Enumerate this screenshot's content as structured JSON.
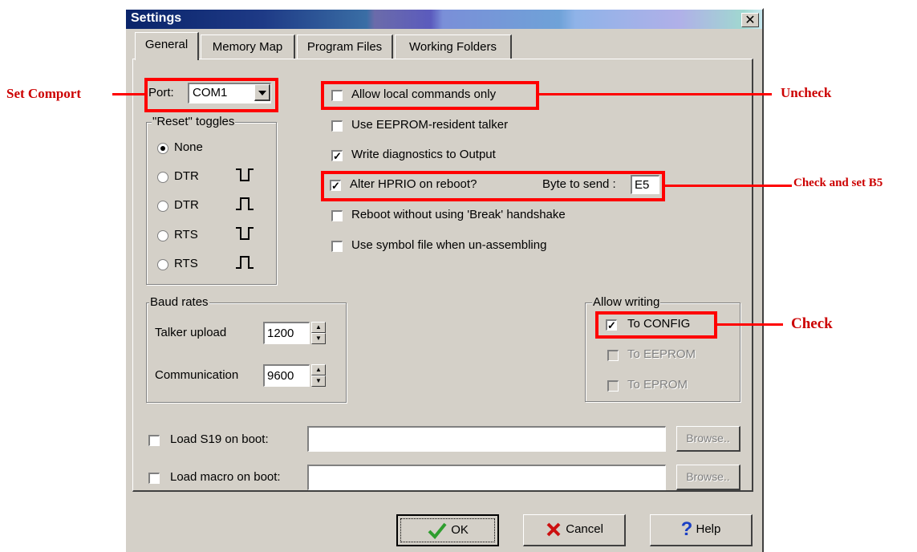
{
  "dialog": {
    "title": "Settings",
    "close_glyph": "✕",
    "tabs": [
      "General",
      "Memory Map",
      "Program Files",
      "Working Folders"
    ],
    "active_tab": "General"
  },
  "port": {
    "label": "Port:",
    "value": "COM1"
  },
  "reset_toggles": {
    "label": "\"Reset\" toggles",
    "options": [
      {
        "label": "None",
        "selected": true,
        "icon": "none"
      },
      {
        "label": "DTR",
        "selected": false,
        "icon": "pulse-low-icon"
      },
      {
        "label": "DTR",
        "selected": false,
        "icon": "pulse-high-icon"
      },
      {
        "label": "RTS",
        "selected": false,
        "icon": "pulse-low-icon"
      },
      {
        "label": "RTS",
        "selected": false,
        "icon": "pulse-high-icon"
      }
    ]
  },
  "options": [
    {
      "label": "Allow local commands only",
      "checked": false
    },
    {
      "label": "Use EEPROM-resident talker",
      "checked": false
    },
    {
      "label": "Write diagnostics to Output",
      "checked": true
    },
    {
      "label": "Alter HPRIO on reboot?",
      "checked": true
    },
    {
      "label": "Reboot without using 'Break' handshake",
      "checked": false
    },
    {
      "label": "Use symbol file when un-assembling",
      "checked": false
    }
  ],
  "byte_to_send": {
    "label": "Byte to send :",
    "value": "E5"
  },
  "baud_rates": {
    "label": "Baud rates",
    "talker_upload": {
      "label": "Talker upload",
      "value": "1200"
    },
    "communication": {
      "label": "Communication",
      "value": "9600"
    }
  },
  "allow_writing": {
    "label": "Allow writing",
    "items": [
      {
        "label": "To CONFIG",
        "checked": true,
        "enabled": true
      },
      {
        "label": "To EEPROM",
        "checked": false,
        "enabled": false
      },
      {
        "label": "To EPROM",
        "checked": false,
        "enabled": false
      }
    ]
  },
  "load_s19": {
    "label": "Load S19 on boot:",
    "value": "",
    "browse": "Browse.."
  },
  "load_macro": {
    "label": "Load macro on boot:",
    "value": "",
    "browse": "Browse.."
  },
  "buttons": {
    "ok": "OK",
    "cancel": "Cancel",
    "help": "Help"
  },
  "annotations": {
    "set_comport": "Set Comport",
    "uncheck": "Uncheck",
    "check_and_set": "Check and set B5",
    "check": "Check"
  },
  "colors": {
    "annotation": "#ff0000",
    "ok_check": "#2e9e2e",
    "cancel_x": "#cc1010",
    "help_q": "#1a3fc4",
    "dialog_bg": "#d4d0c8"
  }
}
